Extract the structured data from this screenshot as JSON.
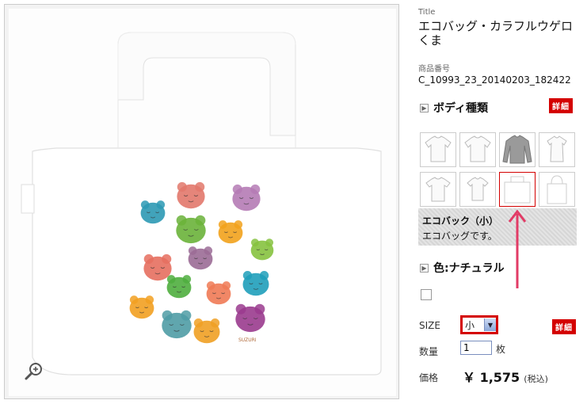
{
  "product": {
    "title_label": "Title",
    "title": "エコバッグ・カラフルウゲロくま",
    "code_label": "商品番号",
    "code": "C_10993_23_20140203_182422",
    "body_section_title": "ボディ種類",
    "detail_label": "詳細",
    "selected_body_name": "エコバック（小）",
    "selected_body_desc": "エコバッグです。",
    "color_section_title": "色:ナチュラル",
    "size_label": "SIZE",
    "size_value": "小",
    "qty_label": "数量",
    "qty_value": "1",
    "qty_unit": "枚",
    "price_label": "価格",
    "price_value": "￥ 1,575",
    "price_tax": "(税込)",
    "watermark": "SUZURI"
  },
  "bears": [
    {
      "color": "#e2786b"
    },
    {
      "color": "#b57bb5"
    },
    {
      "color": "#2c99b4"
    },
    {
      "color": "#6ab23a"
    },
    {
      "color": "#f2a21c"
    },
    {
      "color": "#86c23f"
    },
    {
      "color": "#e66f5f"
    },
    {
      "color": "#9b6c96"
    },
    {
      "color": "#4fae3e"
    },
    {
      "color": "#f07a55"
    },
    {
      "color": "#1f9fba"
    },
    {
      "color": "#f2a021"
    },
    {
      "color": "#4f9ca5"
    },
    {
      "color": "#9a3b8e"
    },
    {
      "color": "#f0a024"
    }
  ],
  "colors": {
    "accent_red": "#d40000",
    "arrow_pink": "#e23b66"
  }
}
